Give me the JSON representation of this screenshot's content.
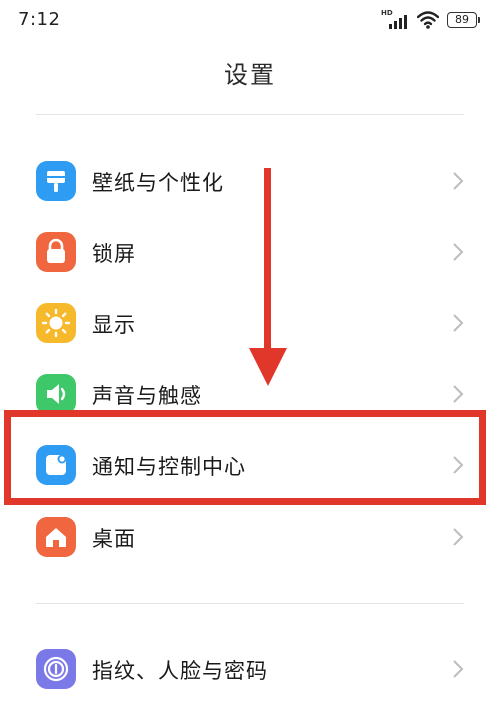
{
  "status_bar": {
    "time": "7:12",
    "network_label": "HD",
    "battery_level": "89"
  },
  "header": {
    "title": "设置"
  },
  "settings_group_1": [
    {
      "label": "壁纸与个性化",
      "icon": "wallpaper-icon",
      "color": "#2f9cf4"
    },
    {
      "label": "锁屏",
      "icon": "lock-icon",
      "color": "#f0663f"
    },
    {
      "label": "显示",
      "icon": "sun-icon",
      "color": "#f6b92b"
    },
    {
      "label": "声音与触感",
      "icon": "speaker-icon",
      "color": "#3ec86a"
    },
    {
      "label": "通知与控制中心",
      "icon": "notification-icon",
      "color": "#2f9cf4"
    },
    {
      "label": "桌面",
      "icon": "home-icon",
      "color": "#f0663f"
    }
  ],
  "settings_group_2": [
    {
      "label": "指纹、人脸与密码",
      "icon": "fingerprint-icon",
      "color": "#7b78e8"
    }
  ],
  "annotation": {
    "highlight_color": "#e0372a"
  }
}
